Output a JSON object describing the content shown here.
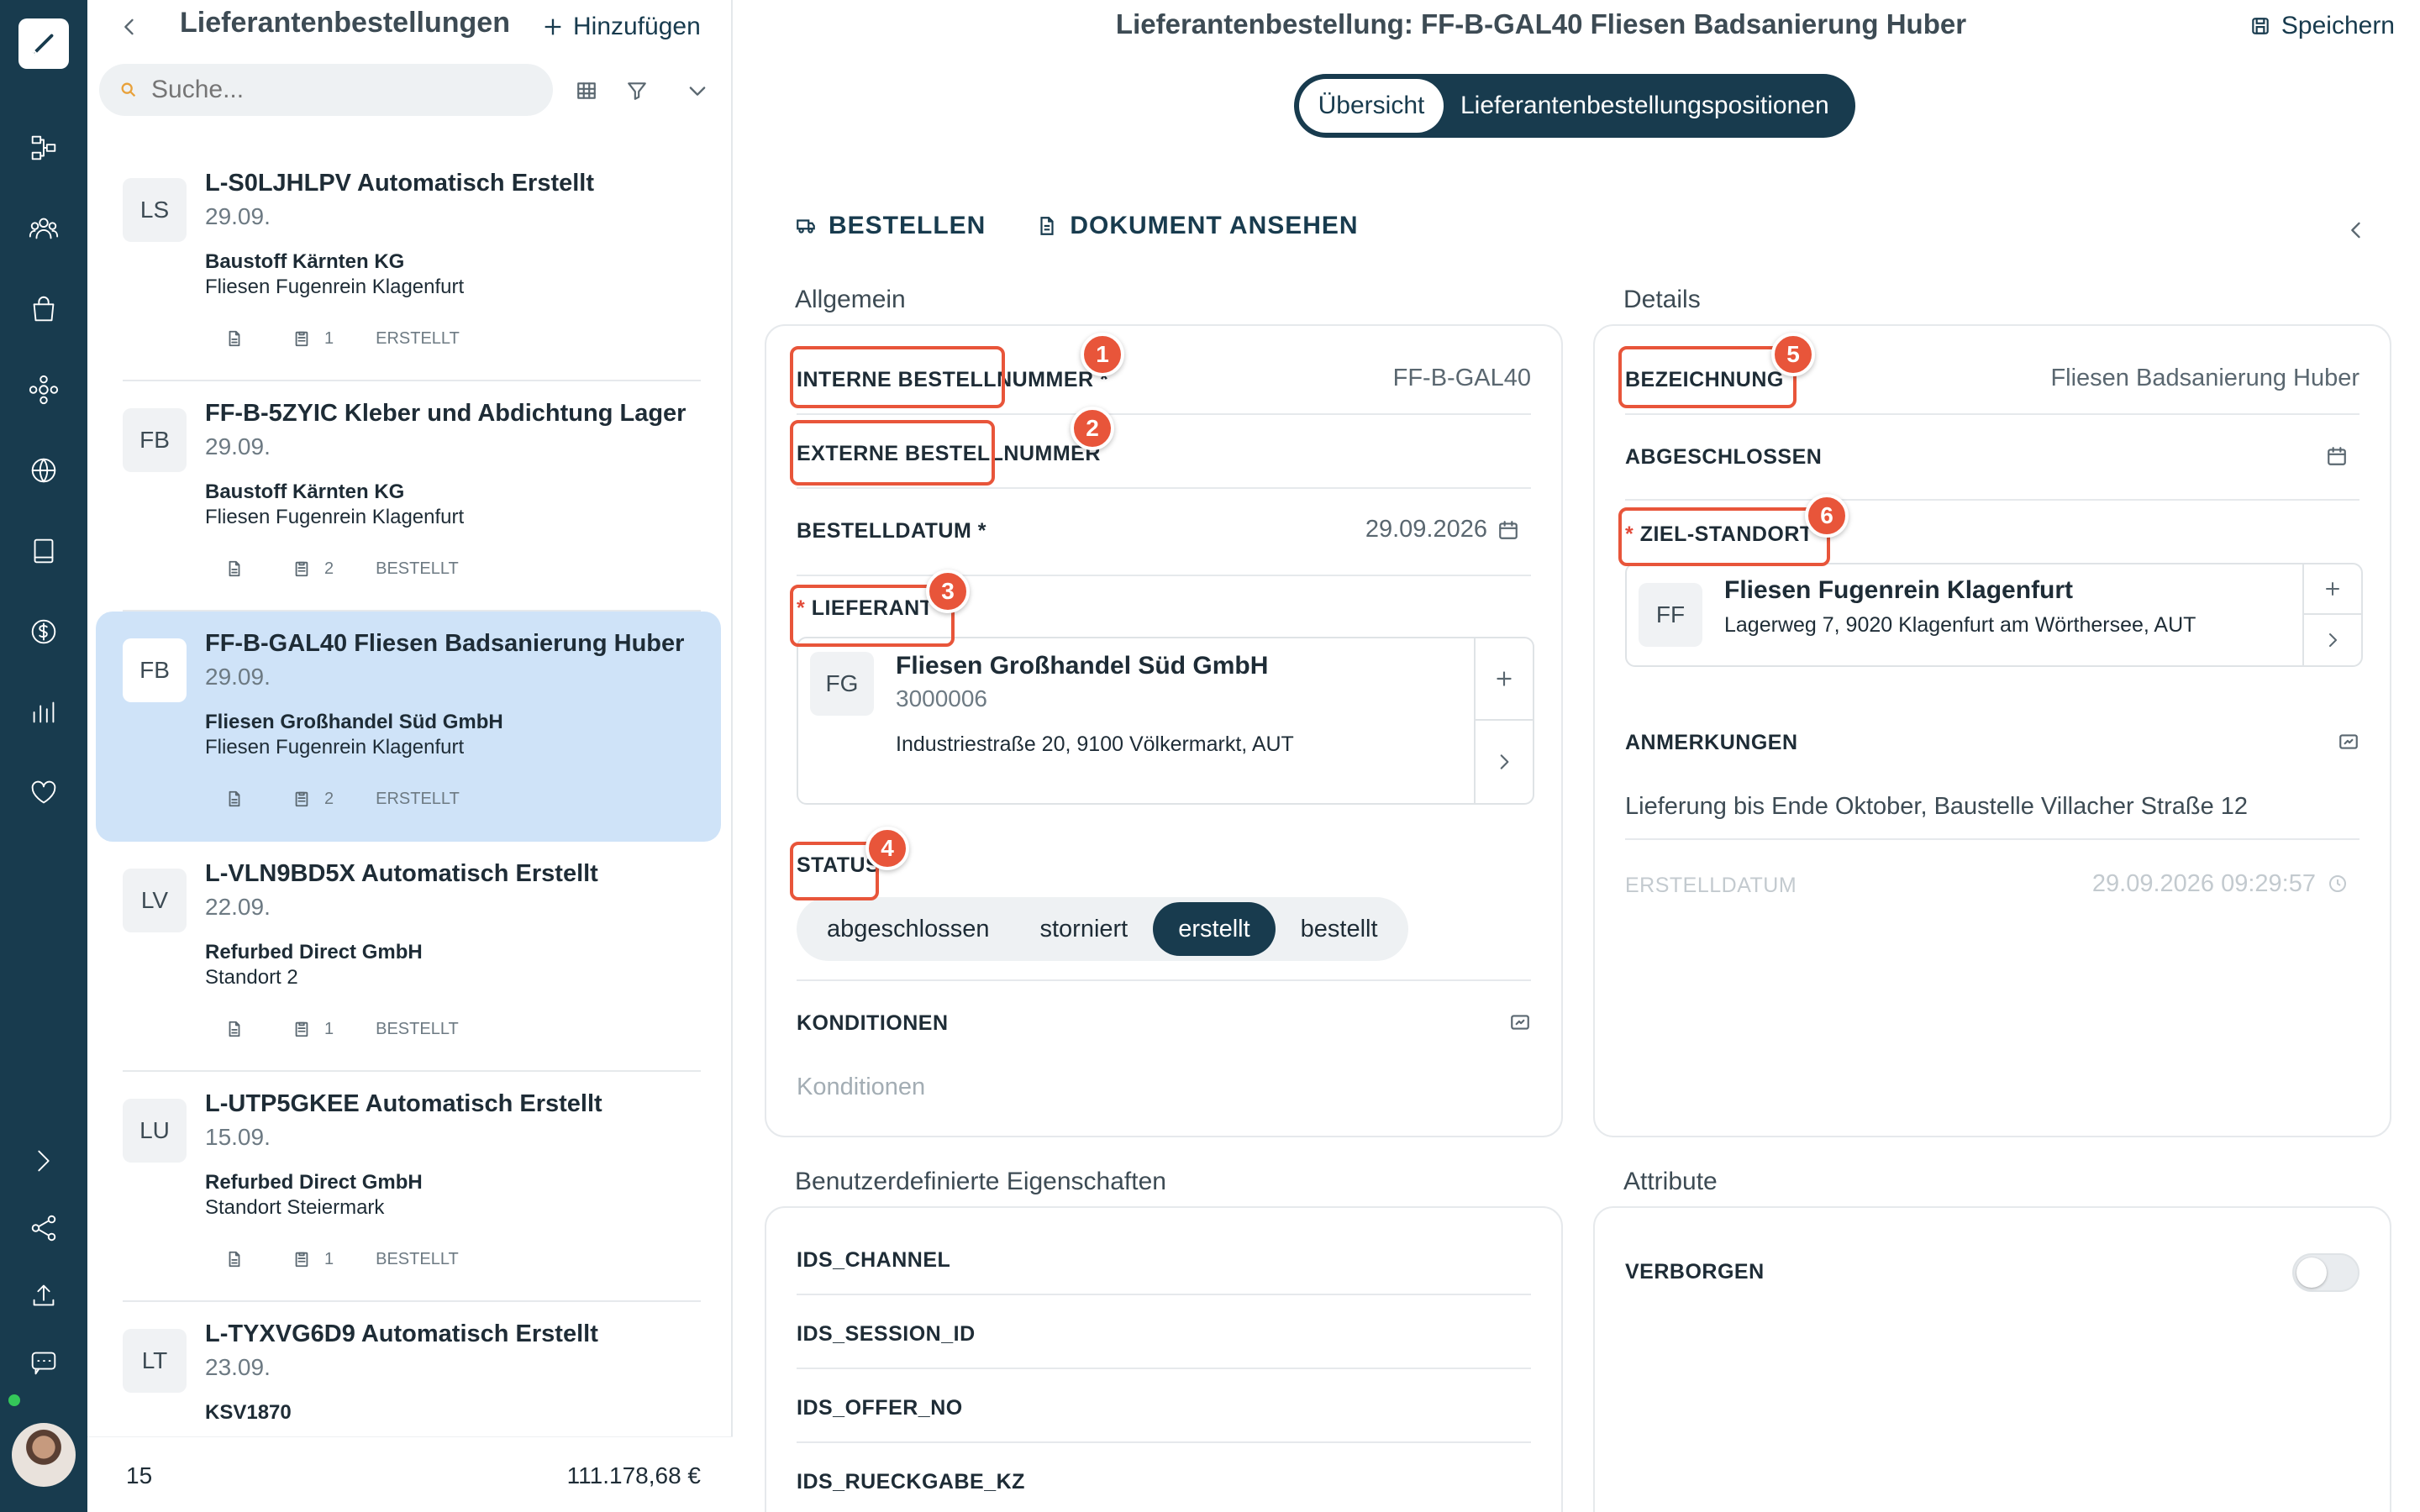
{
  "list": {
    "title": "Lieferantenbestellungen",
    "add_label": "Hinzufügen",
    "search_placeholder": "Suche...",
    "items": [
      {
        "initials": "LS",
        "title": "L-S0LJHLPV Automatisch Erstellt",
        "date": "29.09.",
        "supplier": "Baustoff Kärnten KG",
        "location": "Fliesen Fugenrein Klagenfurt",
        "count": "1",
        "status": "ERSTELLT",
        "selected": false
      },
      {
        "initials": "FB",
        "title": "FF-B-5ZYIC Kleber und Abdichtung Lager",
        "date": "29.09.",
        "supplier": "Baustoff Kärnten KG",
        "location": "Fliesen Fugenrein Klagenfurt",
        "count": "2",
        "status": "BESTELLT",
        "selected": false
      },
      {
        "initials": "FB",
        "title": "FF-B-GAL40 Fliesen Badsanierung Huber",
        "date": "29.09.",
        "supplier": "Fliesen Großhandel Süd GmbH",
        "location": "Fliesen Fugenrein Klagenfurt",
        "count": "2",
        "status": "ERSTELLT",
        "selected": true
      },
      {
        "initials": "LV",
        "title": "L-VLN9BD5X Automatisch Erstellt",
        "date": "22.09.",
        "supplier": "Refurbed Direct GmbH",
        "location": "Standort 2",
        "count": "1",
        "status": "BESTELLT",
        "selected": false
      },
      {
        "initials": "LU",
        "title": "L-UTP5GKEE Automatisch Erstellt",
        "date": "15.09.",
        "supplier": "Refurbed Direct GmbH",
        "location": "Standort Steiermark",
        "count": "1",
        "status": "BESTELLT",
        "selected": false
      },
      {
        "initials": "LT",
        "title": "L-TYXVG6D9 Automatisch Erstellt",
        "date": "23.09.",
        "supplier": "KSV1870",
        "location": "",
        "count": "",
        "status": "",
        "selected": false
      }
    ],
    "footer_count": "15",
    "footer_total": "111.178,68 €"
  },
  "header": {
    "title": "Lieferantenbestellung: FF-B-GAL40 Fliesen Badsanierung Huber",
    "save_label": "Speichern"
  },
  "tabs": [
    "Übersicht",
    "Lieferantenbestellungspositionen"
  ],
  "actions": {
    "order": "BESTELLEN",
    "view_doc": "DOKUMENT ANSEHEN"
  },
  "general": {
    "section": "Allgemein",
    "internal_no_label": "INTERNE BESTELLNUMMER *",
    "internal_no_value": "FF-B-GAL40",
    "external_no_label": "EXTERNE BESTELLNUMMER",
    "order_date_label": "BESTELLDATUM *",
    "order_date_value": "29.09.2026",
    "supplier_label": "LIEFERANT",
    "supplier": {
      "initials": "FG",
      "name": "Fliesen Großhandel Süd GmbH",
      "number": "3000006",
      "address": "Industriestraße 20, 9100 Völkermarkt, AUT"
    },
    "status_label": "STATUS",
    "status_options": [
      "abgeschlossen",
      "storniert",
      "erstellt",
      "bestellt"
    ],
    "status_selected": "erstellt",
    "conditions_label": "KONDITIONEN",
    "conditions_placeholder": "Konditionen"
  },
  "details": {
    "section": "Details",
    "name_label": "BEZEICHNUNG",
    "name_value": "Fliesen Badsanierung Huber",
    "completed_label": "ABGESCHLOSSEN",
    "target_label": "ZIEL-STANDORT",
    "target": {
      "initials": "FF",
      "name": "Fliesen Fugenrein Klagenfurt",
      "address": "Lagerweg 7, 9020 Klagenfurt am Wörthersee, AUT"
    },
    "notes_label": "ANMERKUNGEN",
    "notes_value": "Lieferung bis Ende Oktober, Baustelle Villacher Straße 12",
    "created_label": "ERSTELLDATUM",
    "created_value": "29.09.2026 09:29:57"
  },
  "custom": {
    "section": "Benutzerdefinierte Eigenschaften",
    "fields": [
      "IDS_CHANNEL",
      "IDS_SESSION_ID",
      "IDS_OFFER_NO",
      "IDS_RUECKGABE_KZ"
    ]
  },
  "attributes": {
    "section": "Attribute",
    "hidden_label": "VERBORGEN",
    "hidden_on": false
  },
  "annotations": [
    "1",
    "2",
    "3",
    "4",
    "5",
    "6"
  ],
  "colors": {
    "brand": "#183b4e",
    "highlight": "#e8553a",
    "selected_row": "#cfe3f8"
  }
}
